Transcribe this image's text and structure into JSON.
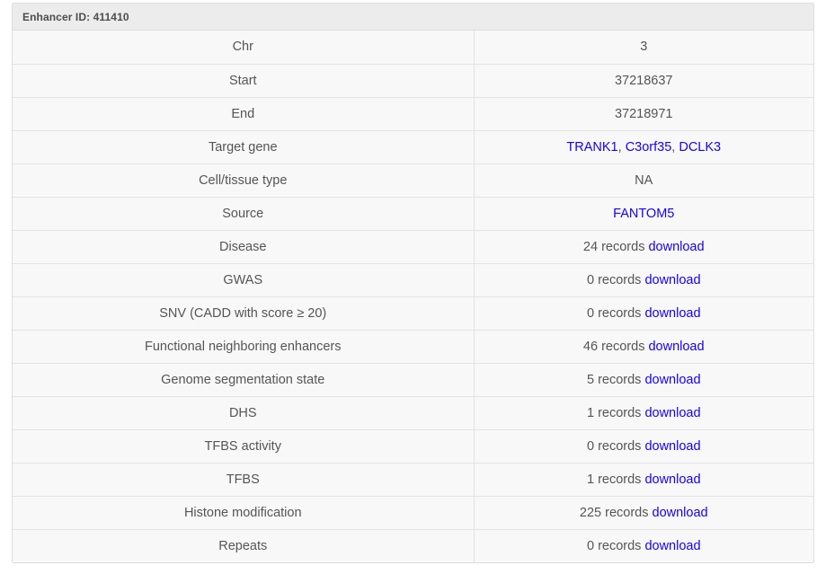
{
  "panel": {
    "heading": "Enhancer ID: 411410"
  },
  "colors": {
    "link": "#1500f5",
    "text": "#555555",
    "heading_bg": "#ececec",
    "body_bg": "#f8f8f8",
    "border": "#dddddd"
  },
  "rows": [
    {
      "label": "Chr",
      "type": "text",
      "value": "3"
    },
    {
      "label": "Start",
      "type": "text",
      "value": "37218637"
    },
    {
      "label": "End",
      "type": "text",
      "value": "37218971"
    },
    {
      "label": "Target gene",
      "type": "links",
      "links": [
        "TRANK1",
        "C3orf35",
        "DCLK3"
      ],
      "separator": ", "
    },
    {
      "label": "Cell/tissue type",
      "type": "text",
      "value": "NA"
    },
    {
      "label": "Source",
      "type": "links",
      "links": [
        "FANTOM5"
      ],
      "separator": ", "
    },
    {
      "label": "Disease",
      "type": "records",
      "count": "24",
      "records_word": "records",
      "download_label": "download"
    },
    {
      "label": "GWAS",
      "type": "records",
      "count": "0",
      "records_word": "records",
      "download_label": "download"
    },
    {
      "label": "SNV (CADD with score ≥ 20)",
      "type": "records",
      "count": "0",
      "records_word": "records",
      "download_label": "download"
    },
    {
      "label": "Functional neighboring enhancers",
      "type": "records",
      "count": "46",
      "records_word": "records",
      "download_label": "download"
    },
    {
      "label": "Genome segmentation state",
      "type": "records",
      "count": "5",
      "records_word": "records",
      "download_label": "download"
    },
    {
      "label": "DHS",
      "type": "records",
      "count": "1",
      "records_word": "records",
      "download_label": "download"
    },
    {
      "label": "TFBS activity",
      "type": "records",
      "count": "0",
      "records_word": "records",
      "download_label": "download"
    },
    {
      "label": "TFBS",
      "type": "records",
      "count": "1",
      "records_word": "records",
      "download_label": "download"
    },
    {
      "label": "Histone modification",
      "type": "records",
      "count": "225",
      "records_word": "records",
      "download_label": "download"
    },
    {
      "label": "Repeats",
      "type": "records",
      "count": "0",
      "records_word": "records",
      "download_label": "download"
    }
  ]
}
